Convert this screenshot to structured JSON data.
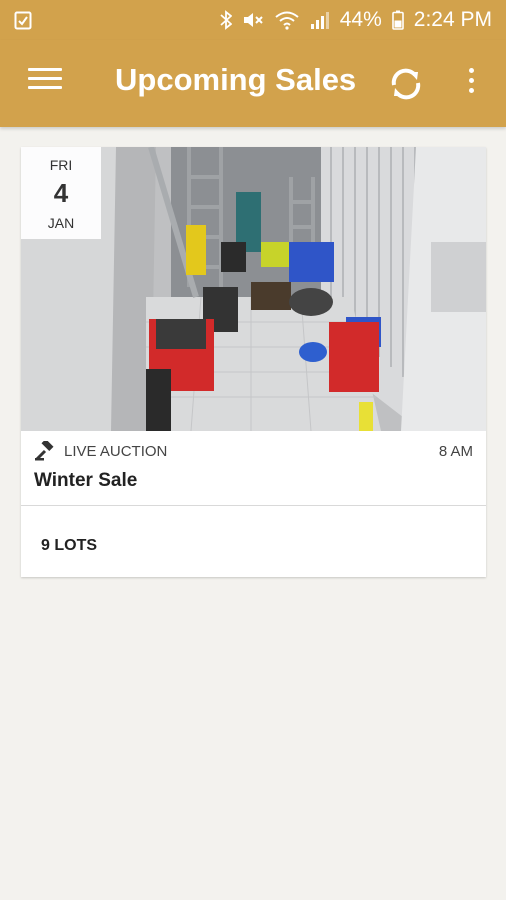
{
  "status_bar": {
    "battery": "44%",
    "time": "2:24 PM",
    "icons": [
      "clipboard-check-icon",
      "bluetooth-icon",
      "mute-icon",
      "wifi-icon",
      "signal-icon",
      "battery-icon"
    ]
  },
  "app_bar": {
    "title": "Upcoming Sales",
    "icons": [
      "menu-icon",
      "refresh-icon",
      "more-vert-icon"
    ]
  },
  "colors": {
    "accent": "#d2a24c",
    "background": "#f3f2ee"
  },
  "sale": {
    "date": {
      "day_of_week": "FRI",
      "day": "4",
      "month": "JAN"
    },
    "type": "LIVE AUCTION",
    "time": "8 AM",
    "name": "Winter Sale",
    "lots": "9 LOTS",
    "type_icon": "gavel-icon"
  }
}
